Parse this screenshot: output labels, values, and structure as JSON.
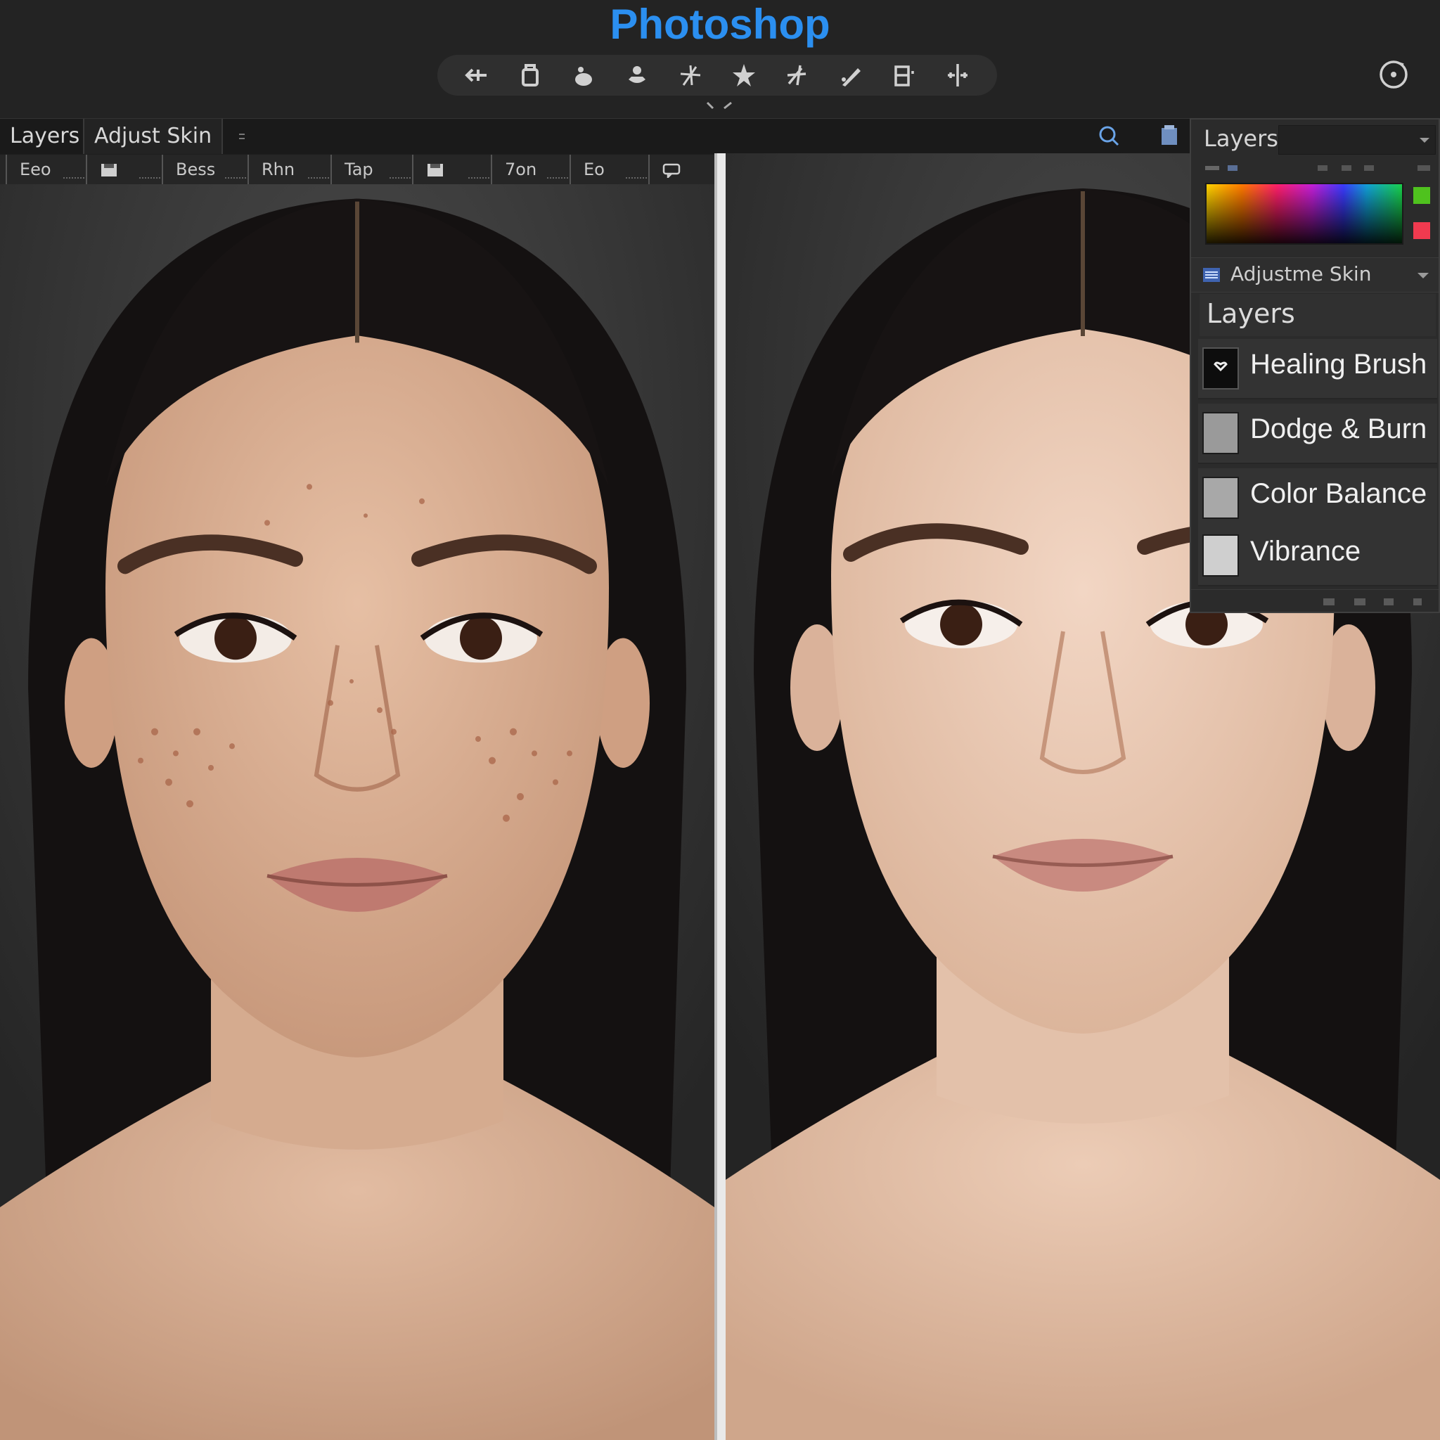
{
  "app": {
    "title": "Photoshop",
    "accent_color": "#2b8ff0"
  },
  "toolbar": {
    "tools": [
      {
        "icon": "move-arrow-icon"
      },
      {
        "icon": "bucket-icon"
      },
      {
        "icon": "blob-brush-icon"
      },
      {
        "icon": "stamp-icon"
      },
      {
        "icon": "sparkle-brush-icon"
      },
      {
        "icon": "star-icon"
      },
      {
        "icon": "spot-heal-icon"
      },
      {
        "icon": "pen-icon"
      },
      {
        "icon": "transform-icon"
      },
      {
        "icon": "split-icon"
      }
    ]
  },
  "tabs": {
    "tab1": "Layers",
    "tab2": "Adjust Skin"
  },
  "options": {
    "items": [
      "Eeo",
      "Bess",
      "Rhn",
      "Tap",
      "7on",
      "Eo"
    ]
  },
  "layers_panel": {
    "title": "Layers",
    "foreground_color": "#4fc21e",
    "background_color": "#f03a4f",
    "adjustment_label": "Adjustme Skin",
    "sub_title": "Layers",
    "layers": [
      {
        "name": "Healing Brush"
      },
      {
        "name": "Dodge & Burn"
      },
      {
        "name": "Color Balance"
      },
      {
        "name": "Vibrance"
      }
    ]
  }
}
